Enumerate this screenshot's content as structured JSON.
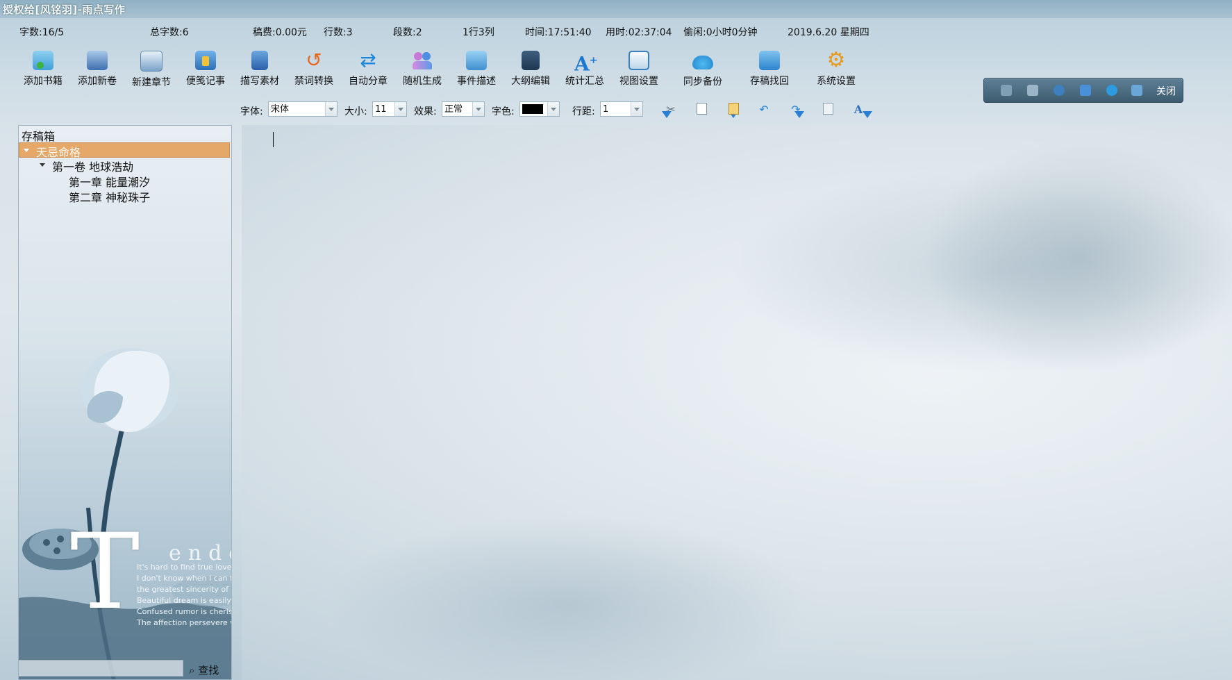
{
  "window": {
    "title": "授权给[风铭羽]-雨点写作"
  },
  "status": {
    "word_count": "字数:16/5",
    "total_words": "总字数:6",
    "fee": "稿费:0.00元",
    "lines": "行数:3",
    "paragraphs": "段数:2",
    "cursor_pos": "1行3列",
    "time": "时间:17:51:40",
    "elapsed": "用时:02:37:04",
    "idle": "偷闲:0小时0分钟",
    "date": "2019.6.20 星期四"
  },
  "toolbar": {
    "items": [
      {
        "label": "添加书籍",
        "icon": "folder-add-icon"
      },
      {
        "label": "添加新卷",
        "icon": "volume-add-icon"
      },
      {
        "label": "新建章节",
        "icon": "new-chapter-icon"
      },
      {
        "label": "便笺记事",
        "icon": "notepad-icon"
      },
      {
        "label": "描写素材",
        "icon": "material-book-icon"
      },
      {
        "label": "禁词转换",
        "icon": "undo-arrow-icon"
      },
      {
        "label": "自动分章",
        "icon": "sync-arrows-icon"
      },
      {
        "label": "随机生成",
        "icon": "people-icon"
      },
      {
        "label": "事件描述",
        "icon": "event-folder-icon"
      },
      {
        "label": "大纲编辑",
        "icon": "outline-book-icon"
      },
      {
        "label": "统计汇总",
        "icon": "font-stats-icon"
      },
      {
        "label": "视图设置",
        "icon": "view-window-icon"
      },
      {
        "label": "同步备份",
        "icon": "cloud-sync-icon"
      },
      {
        "label": "存稿找回",
        "icon": "recover-folder-icon"
      },
      {
        "label": "系统设置",
        "icon": "gear-icon"
      }
    ]
  },
  "quickbar": {
    "close_label": "关闭"
  },
  "format": {
    "font_label": "字体:",
    "font_value": "宋体",
    "size_label": "大小:",
    "size_value": "11",
    "effect_label": "效果:",
    "effect_value": "正常",
    "color_label": "字色:",
    "color_value": "#000000",
    "spacing_label": "行距:",
    "spacing_value": "1"
  },
  "sidebar": {
    "header": "存稿箱",
    "book": "天忌命格",
    "volume": "第一卷  地球浩劫",
    "chapters": [
      "第一章  能量潮汐",
      "第二章  神秘珠子"
    ],
    "search_label": "查找"
  },
  "artwork": {
    "big_letter": "T",
    "word": "ender",
    "lines": [
      "It's hard to find true love.",
      "I don't know when I can fall in with",
      "the greatest sincerity of love in the vicissitudes of life.",
      "Beautiful dream is easily broken.",
      "Confused rumor is cherished more.",
      "The affection persevere with painfully and regret."
    ]
  },
  "colors": {
    "selection": "#e6a869",
    "accent": "#2a7fd4"
  }
}
